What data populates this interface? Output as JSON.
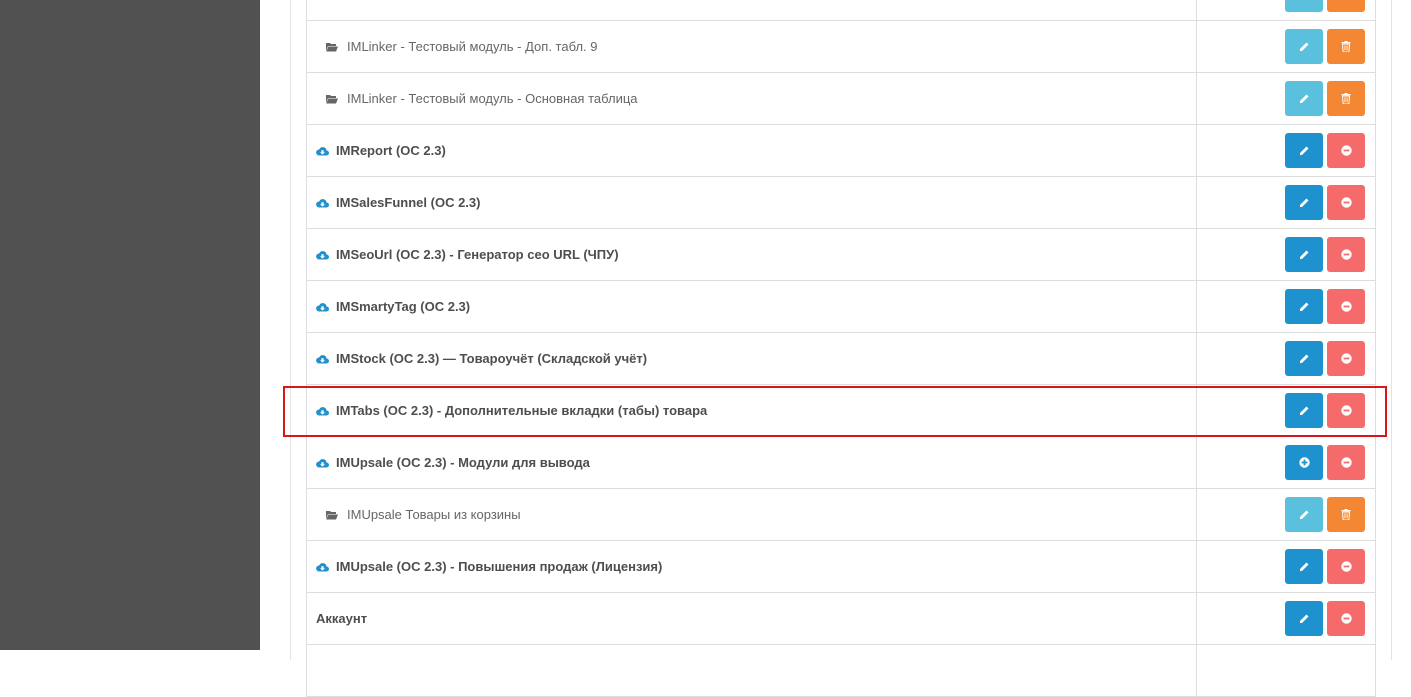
{
  "colors": {
    "sidebar": "#515151",
    "btn_primary": "#1e91cf",
    "btn_info": "#5bc0de",
    "btn_danger": "#f56b6b",
    "btn_warning": "#f38733",
    "highlight": "#d9161c",
    "cloud_icon": "#1e91cf"
  },
  "rows": [
    {
      "label": "",
      "type": "child",
      "icon": "folder-open-icon",
      "actions": [
        "pencil-icon",
        "trash-icon"
      ]
    },
    {
      "label": "IMLinker - Тестовый модуль - Доп. табл. 9",
      "type": "child",
      "icon": "folder-open-icon",
      "actions": [
        "pencil-icon",
        "trash-icon"
      ]
    },
    {
      "label": "IMLinker - Тестовый модуль - Основная таблица",
      "type": "child",
      "icon": "folder-open-icon",
      "actions": [
        "pencil-icon",
        "trash-icon"
      ]
    },
    {
      "label": "IMReport (OC 2.3)",
      "type": "module",
      "icon": "cloud-download-icon",
      "actions": [
        "pencil-icon",
        "minus-circle-icon"
      ]
    },
    {
      "label": "IMSalesFunnel (OC 2.3)",
      "type": "module",
      "icon": "cloud-download-icon",
      "actions": [
        "pencil-icon",
        "minus-circle-icon"
      ]
    },
    {
      "label": "IMSeoUrl (OC 2.3) - Генератор сео URL (ЧПУ)",
      "type": "module",
      "icon": "cloud-download-icon",
      "actions": [
        "pencil-icon",
        "minus-circle-icon"
      ]
    },
    {
      "label": "IMSmartyTag (OC 2.3)",
      "type": "module",
      "icon": "cloud-download-icon",
      "actions": [
        "pencil-icon",
        "minus-circle-icon"
      ]
    },
    {
      "label": "IMStock (OC 2.3) — Товароучёт (Складской учёт)",
      "type": "module",
      "icon": "cloud-download-icon",
      "actions": [
        "pencil-icon",
        "minus-circle-icon"
      ]
    },
    {
      "label": "IMTabs (OC 2.3) - Дополнительные вкладки (табы) товара",
      "type": "module",
      "icon": "cloud-download-icon",
      "actions": [
        "pencil-icon",
        "minus-circle-icon"
      ],
      "highlighted": true
    },
    {
      "label": "IMUpsale (OC 2.3) - Модули для вывода",
      "type": "module",
      "icon": "cloud-download-icon",
      "actions": [
        "plus-circle-icon",
        "minus-circle-icon"
      ]
    },
    {
      "label": "IMUpsale Товары из корзины",
      "type": "child",
      "icon": "folder-open-icon",
      "actions": [
        "pencil-icon",
        "trash-icon"
      ]
    },
    {
      "label": "IMUpsale (OC 2.3) - Повышения продаж (Лицензия)",
      "type": "module",
      "icon": "cloud-download-icon",
      "actions": [
        "pencil-icon",
        "minus-circle-icon"
      ]
    },
    {
      "label": "Аккаунт",
      "type": "plain",
      "icon": "",
      "actions": [
        "pencil-icon",
        "minus-circle-icon"
      ]
    },
    {
      "label": "",
      "type": "plain",
      "icon": "",
      "actions": []
    }
  ]
}
